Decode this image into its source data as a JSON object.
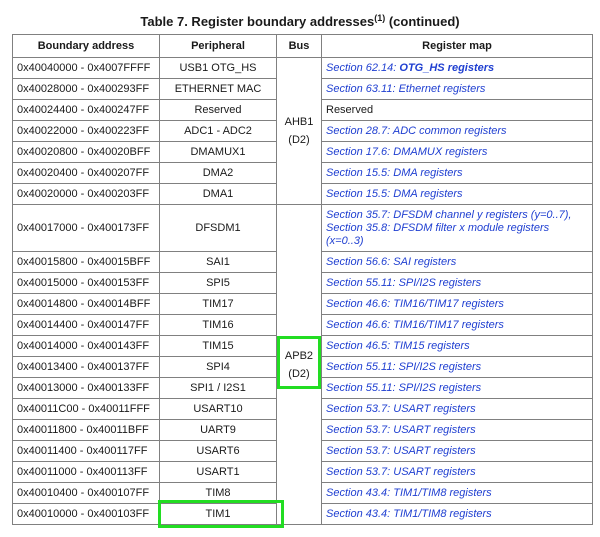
{
  "caption": {
    "main": "Table 7. Register boundary addresses",
    "sup": "(1)",
    "suffix": " (continued)"
  },
  "headers": {
    "address": "Boundary address",
    "peripheral": "Peripheral",
    "bus": "Bus",
    "map": "Register map"
  },
  "bus_groups": [
    {
      "line1": "AHB1",
      "line2": "(D2)"
    },
    {
      "line1": "APB2",
      "line2": "(D2)"
    }
  ],
  "rows": [
    {
      "address": "0x40040000 - 0x4007FFFF",
      "peripheral": "USB1 OTG_HS",
      "map_prefix": "Section 62.14: ",
      "map_bold": "OTG_HS registers",
      "map_lines": []
    },
    {
      "address": "0x40028000 - 0x400293FF",
      "peripheral": "ETHERNET MAC",
      "map_prefix": "Section 63.11: Ethernet registers",
      "map_bold": "",
      "map_lines": []
    },
    {
      "address": "0x40024400 - 0x400247FF",
      "peripheral": "Reserved",
      "map_prefix": "Reserved",
      "map_bold": "",
      "map_lines": [],
      "map_plain": true
    },
    {
      "address": "0x40022000 - 0x400223FF",
      "peripheral": "ADC1 - ADC2",
      "map_prefix": "Section 28.7: ADC common registers",
      "map_bold": "",
      "map_lines": []
    },
    {
      "address": "0x40020800 - 0x40020BFF",
      "peripheral": "DMAMUX1",
      "map_prefix": "Section 17.6: DMAMUX registers",
      "map_bold": "",
      "map_lines": []
    },
    {
      "address": "0x40020400 - 0x400207FF",
      "peripheral": "DMA2",
      "map_prefix": "Section 15.5: DMA registers",
      "map_bold": "",
      "map_lines": []
    },
    {
      "address": "0x40020000 - 0x400203FF",
      "peripheral": "DMA1",
      "map_prefix": "Section 15.5: DMA registers",
      "map_bold": "",
      "map_lines": []
    },
    {
      "address": "0x40017000 - 0x400173FF",
      "peripheral": "DFSDM1",
      "map_prefix": "",
      "map_bold": "",
      "map_lines": [
        "Section 35.7: DFSDM channel y registers (y=0..7),",
        "Section 35.8: DFSDM filter x module registers",
        "(x=0..3)"
      ]
    },
    {
      "address": "0x40015800 - 0x40015BFF",
      "peripheral": "SAI1",
      "map_prefix": "Section 56.6: SAI registers",
      "map_bold": "",
      "map_lines": []
    },
    {
      "address": "0x40015000 - 0x400153FF",
      "peripheral": "SPI5",
      "map_prefix": "Section 55.11: SPI/I2S registers",
      "map_bold": "",
      "map_lines": []
    },
    {
      "address": "0x40014800 - 0x40014BFF",
      "peripheral": "TIM17",
      "map_prefix": "Section 46.6: TIM16/TIM17 registers",
      "map_bold": "",
      "map_lines": []
    },
    {
      "address": "0x40014400 - 0x400147FF",
      "peripheral": "TIM16",
      "map_prefix": "Section 46.6: TIM16/TIM17 registers",
      "map_bold": "",
      "map_lines": []
    },
    {
      "address": "0x40014000 - 0x400143FF",
      "peripheral": "TIM15",
      "map_prefix": "Section 46.5: TIM15 registers",
      "map_bold": "",
      "map_lines": []
    },
    {
      "address": "0x40013400 - 0x400137FF",
      "peripheral": "SPI4",
      "map_prefix": "Section 55.11: SPI/I2S registers",
      "map_bold": "",
      "map_lines": []
    },
    {
      "address": "0x40013000 - 0x400133FF",
      "peripheral": "SPI1 / I2S1",
      "map_prefix": "Section 55.11: SPI/I2S registers",
      "map_bold": "",
      "map_lines": []
    },
    {
      "address": "0x40011C00 - 0x40011FFF",
      "peripheral": "USART10",
      "map_prefix": "Section 53.7: USART registers",
      "map_bold": "",
      "map_lines": []
    },
    {
      "address": "0x40011800 - 0x40011BFF",
      "peripheral": "UART9",
      "map_prefix": "Section 53.7: USART registers",
      "map_bold": "",
      "map_lines": []
    },
    {
      "address": "0x40011400 - 0x400117FF",
      "peripheral": "USART6",
      "map_prefix": "Section 53.7: USART registers",
      "map_bold": "",
      "map_lines": []
    },
    {
      "address": "0x40011000 - 0x400113FF",
      "peripheral": "USART1",
      "map_prefix": "Section 53.7: USART registers",
      "map_bold": "",
      "map_lines": []
    },
    {
      "address": "0x40010400 - 0x400107FF",
      "peripheral": "TIM8",
      "map_prefix": "Section 43.4: TIM1/TIM8 registers",
      "map_bold": "",
      "map_lines": []
    },
    {
      "address": "0x40010000 - 0x400103FF",
      "peripheral": "TIM1",
      "map_prefix": "Section 43.4: TIM1/TIM8 registers",
      "map_bold": "",
      "map_lines": []
    }
  ],
  "highlight_color": "#22dd22",
  "link_color": "#1f3fd1"
}
